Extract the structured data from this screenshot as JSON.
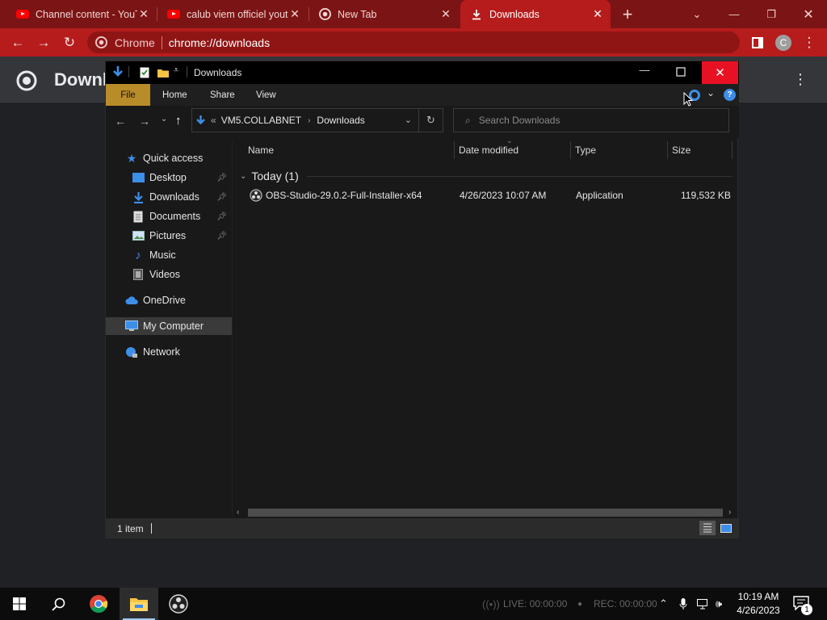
{
  "chrome": {
    "tabs": [
      {
        "title": "Channel content - YouTube",
        "icon": "youtube-icon",
        "active": false
      },
      {
        "title": "calub viem officiel youtube",
        "icon": "youtube-icon",
        "active": false
      },
      {
        "title": "New Tab",
        "icon": "chrome-icon",
        "active": false
      },
      {
        "title": "Downloads",
        "icon": "download-icon",
        "active": true
      }
    ],
    "new_tab_label": "+",
    "omnibox": {
      "chip": "Chrome",
      "url": "chrome://downloads"
    },
    "profile_initial": "C",
    "page_title": "Downl",
    "theme_color": "#b71c1c"
  },
  "explorer": {
    "title": "Downloads",
    "ribbon_tabs": [
      "File",
      "Home",
      "Share",
      "View"
    ],
    "breadcrumb": {
      "prefix": "«",
      "parent": "VM5.COLLABNET",
      "current": "Downloads"
    },
    "search_placeholder": "Search Downloads",
    "tree": [
      {
        "label": "Quick access",
        "icon": "star-icon",
        "indent": 0,
        "pinned": false,
        "selected": false
      },
      {
        "label": "Desktop",
        "icon": "desktop-icon",
        "indent": 1,
        "pinned": true,
        "selected": false
      },
      {
        "label": "Downloads",
        "icon": "download-folder-icon",
        "indent": 1,
        "pinned": true,
        "selected": false
      },
      {
        "label": "Documents",
        "icon": "documents-icon",
        "indent": 1,
        "pinned": true,
        "selected": false
      },
      {
        "label": "Pictures",
        "icon": "pictures-icon",
        "indent": 1,
        "pinned": true,
        "selected": false
      },
      {
        "label": "Music",
        "icon": "music-icon",
        "indent": 1,
        "pinned": false,
        "selected": false
      },
      {
        "label": "Videos",
        "icon": "videos-icon",
        "indent": 1,
        "pinned": false,
        "selected": false
      },
      {
        "label": "OneDrive",
        "icon": "cloud-icon",
        "indent": 0,
        "pinned": false,
        "selected": false
      },
      {
        "label": "My Computer",
        "icon": "computer-icon",
        "indent": 0,
        "pinned": false,
        "selected": true
      },
      {
        "label": "Network",
        "icon": "network-icon",
        "indent": 0,
        "pinned": false,
        "selected": false
      }
    ],
    "columns": {
      "name": "Name",
      "date": "Date modified",
      "type": "Type",
      "size": "Size"
    },
    "group_label": "Today (1)",
    "files": [
      {
        "name": "OBS-Studio-29.0.2-Full-Installer-x64",
        "date": "4/26/2023 10:07 AM",
        "type": "Application",
        "size": "119,532 KB",
        "icon": "obs-icon"
      }
    ],
    "status": "1 item"
  },
  "taskbar": {
    "apps": [
      "start-icon",
      "search-icon",
      "chrome-icon",
      "file-explorer-icon",
      "obs-icon"
    ],
    "obs_live": "LIVE: 00:00:00",
    "obs_rec": "REC: 00:00:00",
    "time": "10:19 AM",
    "date": "4/26/2023",
    "notification_count": "1"
  }
}
